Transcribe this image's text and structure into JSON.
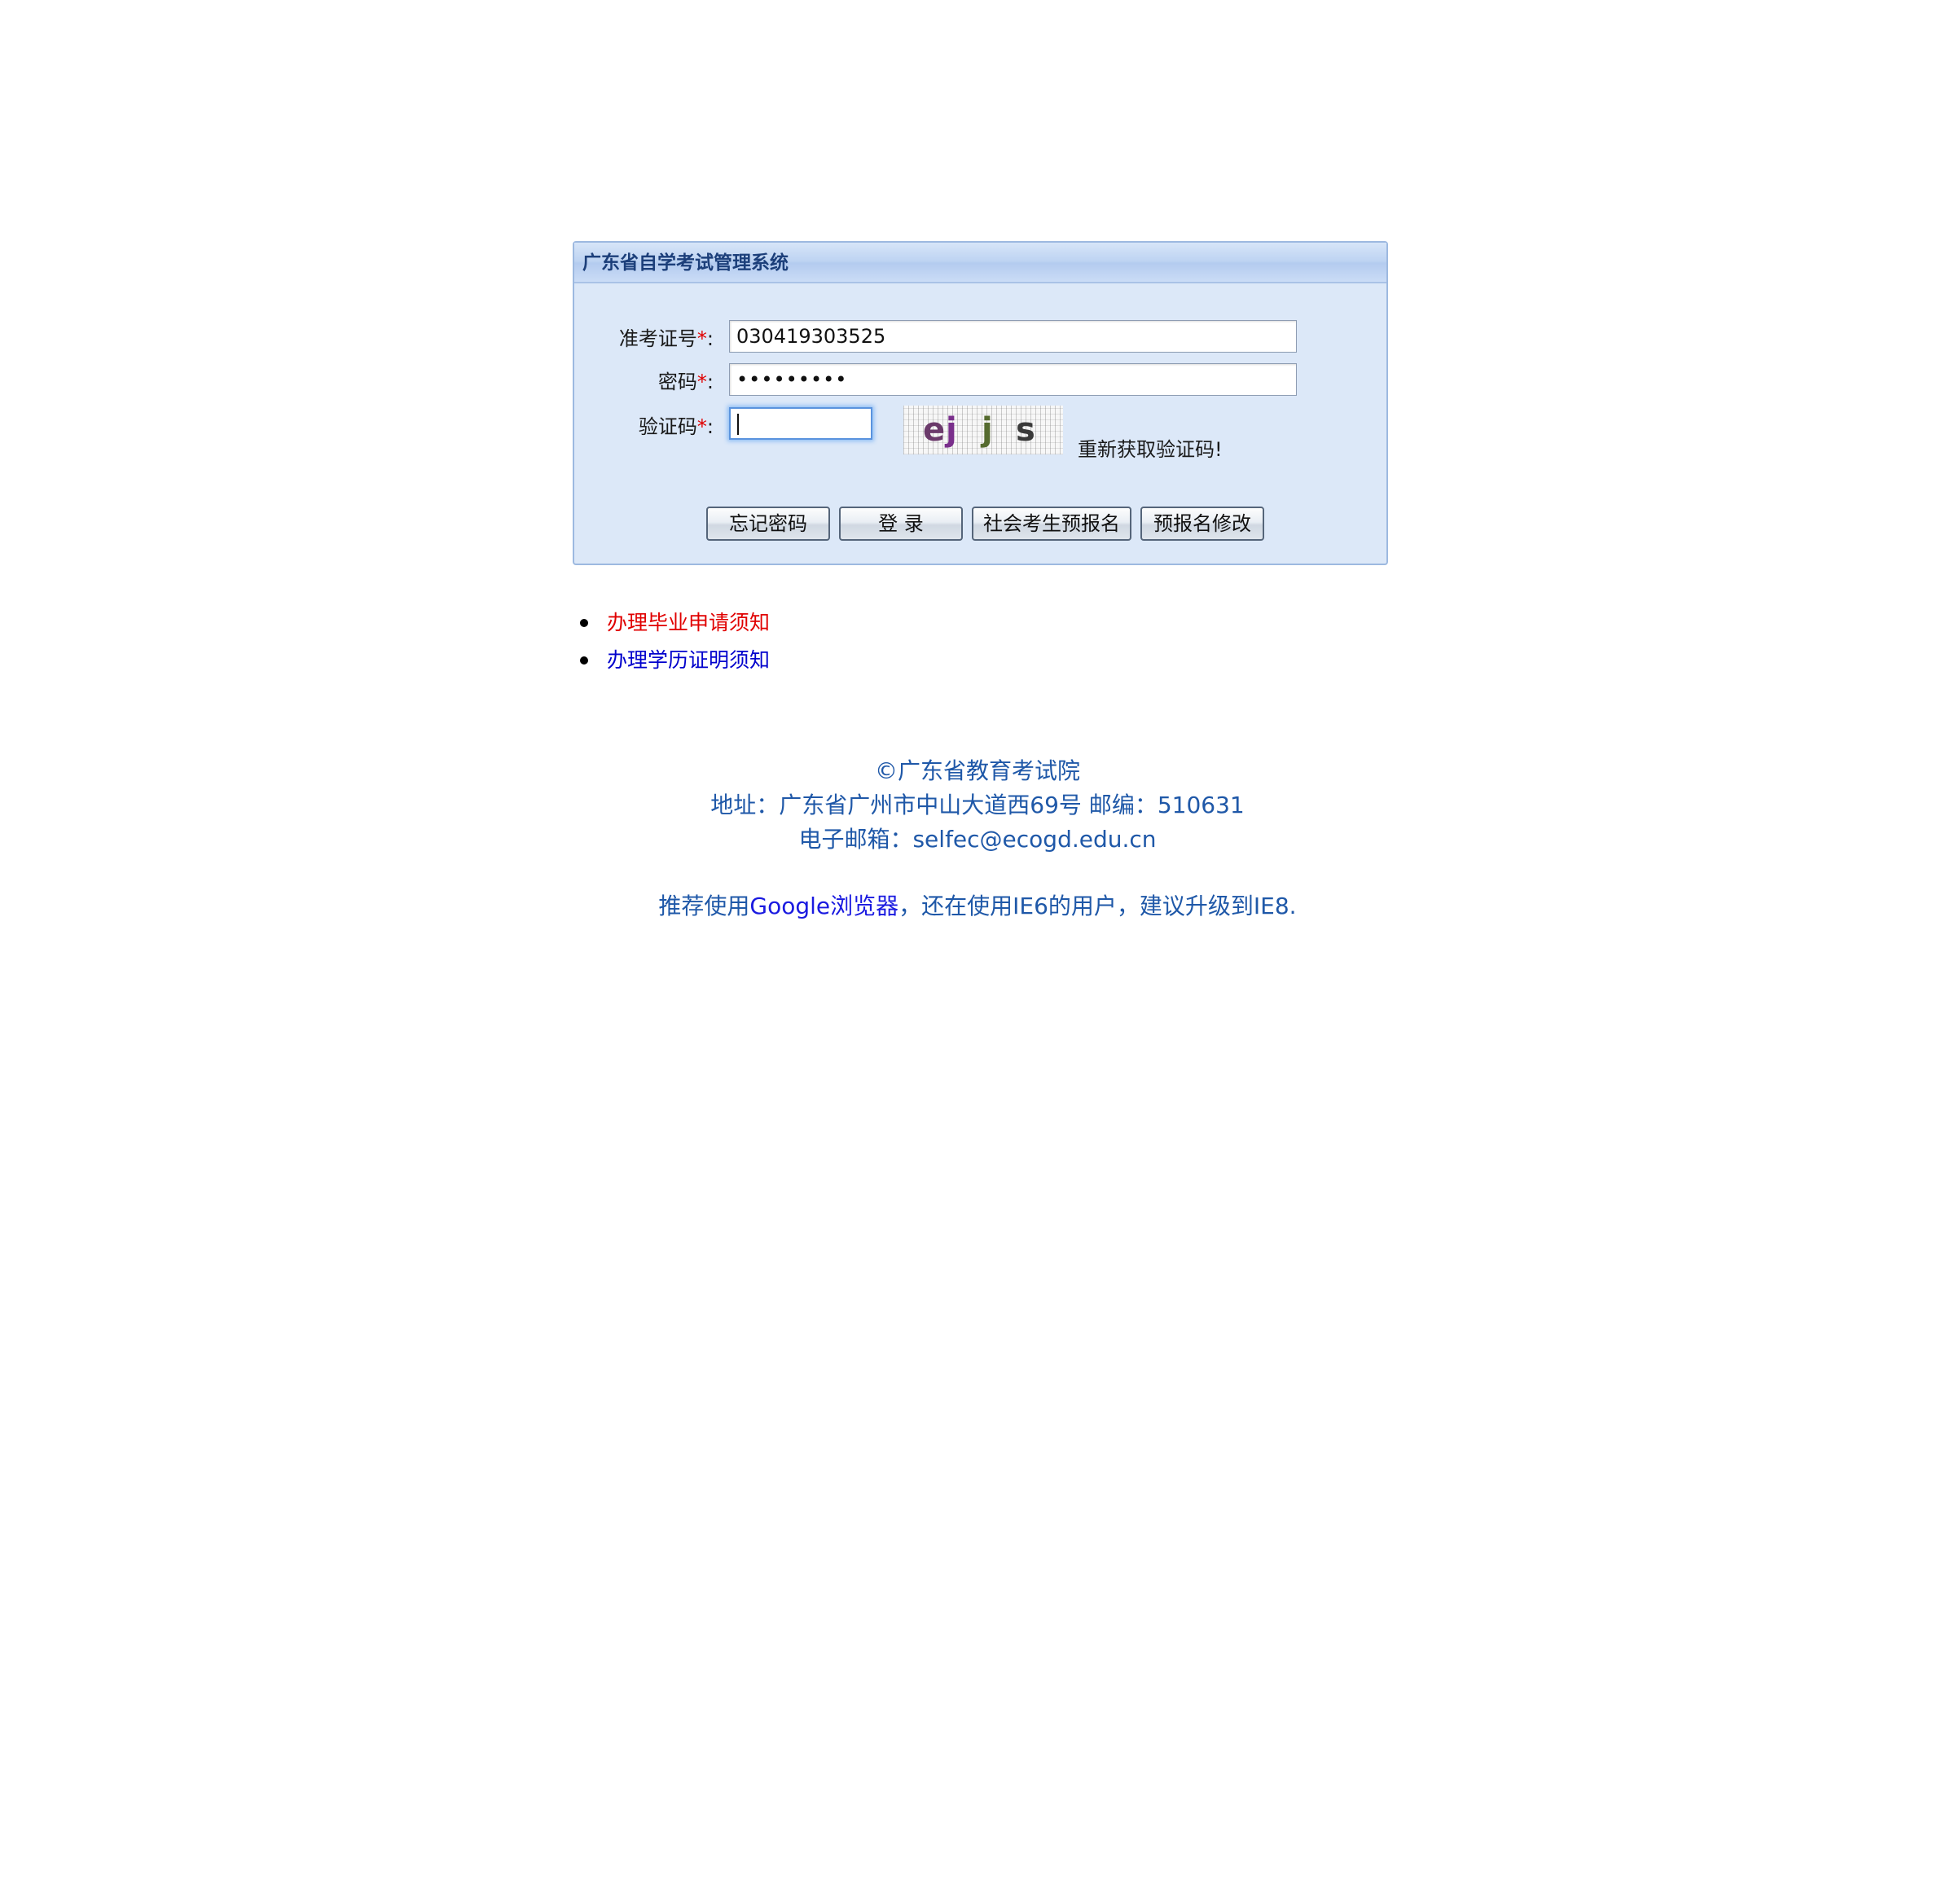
{
  "panel": {
    "title": "广东省自学考试管理系统"
  },
  "form": {
    "exam_id": {
      "label": "准考证号",
      "required_mark": "*",
      "colon": ":",
      "value": "030419303525"
    },
    "password": {
      "label": "密码",
      "required_mark": "*",
      "colon": ":",
      "masked_value": "•••••••••"
    },
    "captcha": {
      "label": "验证码",
      "required_mark": "*",
      "colon": ":",
      "value": "",
      "image_chars": [
        "e",
        "j",
        "j",
        "s"
      ],
      "refresh_link": "重新获取验证码!"
    }
  },
  "buttons": {
    "forgot_password": "忘记密码",
    "login": "登 录",
    "social_preregister": "社会考生预报名",
    "modify_preregister": "预报名修改"
  },
  "notices": [
    {
      "text": "办理毕业申请须知",
      "color": "#e00000"
    },
    {
      "text": "办理学历证明须知",
      "color": "#0000cc"
    }
  ],
  "footer": {
    "copyright": "©广东省教育考试院",
    "address": "地址：广东省广州市中山大道西69号 邮编：510631",
    "email": "电子邮箱：selfec@ecogd.edu.cn",
    "browser_prefix": "推荐使用",
    "browser_link": "Google浏览器",
    "browser_suffix": "，还在使用IE6的用户，建议升级到IE8."
  },
  "colors": {
    "panel_bg": "#dce8f8",
    "panel_border": "#9db9e0",
    "header_text": "#1c3f7a",
    "required": "#e00000",
    "footer_text": "#1f58a8",
    "link_blue": "#1a1ae0"
  }
}
